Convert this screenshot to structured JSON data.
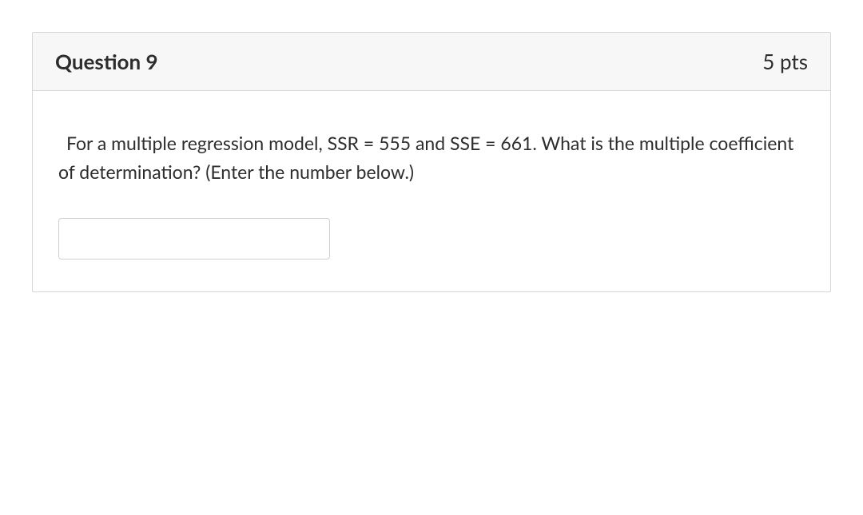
{
  "question": {
    "title": "Question 9",
    "points": "5 pts",
    "prompt": "For a multiple regression model, SSR = 555 and SSE = 661. What is the multiple coefficient of determination?  (Enter the number below.)",
    "answer_value": ""
  }
}
